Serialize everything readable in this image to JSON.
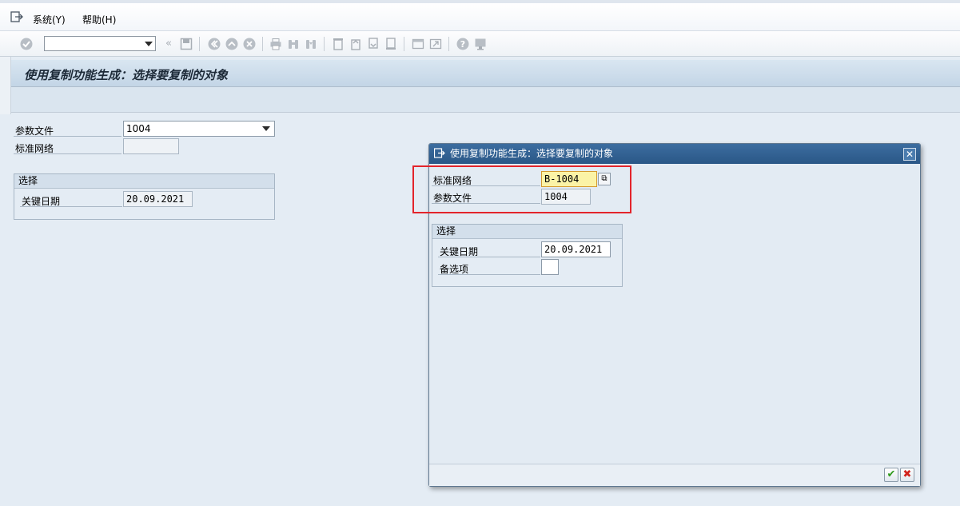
{
  "menubar": {
    "items": [
      {
        "label": "系统(Y)"
      },
      {
        "label": "帮助(H)"
      }
    ]
  },
  "toolbar": {
    "command_field_value": ""
  },
  "title": "使用复制功能生成：选择要复制的对象",
  "main": {
    "fields": {
      "profile_label": "参数文件",
      "profile_value": "1004",
      "std_network_label": "标准网络",
      "std_network_value": ""
    },
    "selection": {
      "title": "选择",
      "key_date_label": "关键日期",
      "key_date_value": "20.09.2021"
    }
  },
  "dialog": {
    "title": "使用复制功能生成：选择要复制的对象",
    "fields": {
      "std_network_label": "标准网络",
      "std_network_value": "B-1004",
      "profile_label": "参数文件",
      "profile_value": "1004"
    },
    "selection": {
      "title": "选择",
      "key_date_label": "关键日期",
      "key_date_value": "20.09.2021",
      "alternative_label": "备选项",
      "alternative_value": ""
    },
    "ok_icon": "check-icon",
    "cancel_icon": "cancel-icon"
  },
  "colors": {
    "title_gradient": "#c3d5e6",
    "dialog_title": "#2a5787",
    "highlight": "#e3242b",
    "focus_field": "#fbf3a6"
  }
}
